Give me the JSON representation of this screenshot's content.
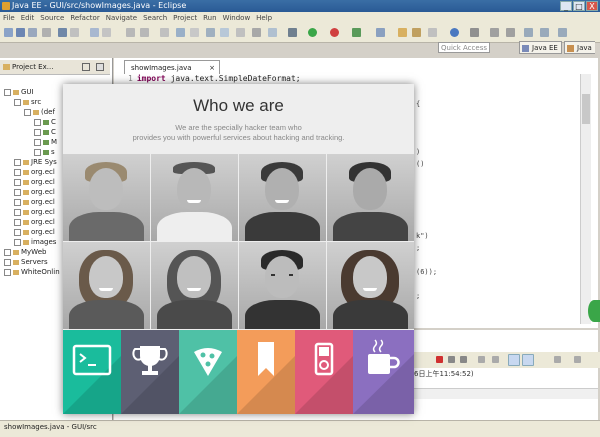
{
  "window": {
    "title": "Java EE - GUI/src/showImages.java - Eclipse",
    "buttons": [
      "_",
      "□",
      "X"
    ]
  },
  "menu": [
    "File",
    "Edit",
    "Source",
    "Refactor",
    "Navigate",
    "Search",
    "Project",
    "Run",
    "Window",
    "Help"
  ],
  "toolbar": {
    "quick_access_placeholder": "Quick Access",
    "perspectives": [
      "Java EE",
      "Java"
    ]
  },
  "project_explorer": {
    "tab_label": "Project Ex...",
    "tree": [
      {
        "label": "GUI",
        "depth": 0
      },
      {
        "label": "src",
        "depth": 1
      },
      {
        "label": "(def",
        "depth": 2
      },
      {
        "label": "C",
        "depth": 3
      },
      {
        "label": "C",
        "depth": 3
      },
      {
        "label": "M",
        "depth": 3
      },
      {
        "label": "s",
        "depth": 3
      },
      {
        "label": "JRE Sys",
        "depth": 1
      },
      {
        "label": "org.ecl",
        "depth": 1
      },
      {
        "label": "org.ecl",
        "depth": 1
      },
      {
        "label": "org.ecl",
        "depth": 1
      },
      {
        "label": "org.ecl",
        "depth": 1
      },
      {
        "label": "org.ecl",
        "depth": 1
      },
      {
        "label": "org.ecl",
        "depth": 1
      },
      {
        "label": "org.ecl",
        "depth": 1
      },
      {
        "label": "images",
        "depth": 1
      },
      {
        "label": "MyWeb",
        "depth": 0
      },
      {
        "label": "Servers",
        "depth": 0
      },
      {
        "label": "WhiteOnlin",
        "depth": 0
      }
    ]
  },
  "editor": {
    "tab_label": "showImages.java",
    "line_number": "1",
    "code_keyword": "import",
    "code_rest": "java.text.SimpleDateFormat;",
    "fragments": [
      "{",
      ")",
      "()",
      "k\")",
      ";",
      "(6));",
      ";"
    ]
  },
  "console": {
    "timestamp": "6日上午11:54:52)"
  },
  "status": {
    "text": "showImages.java - GUI/src"
  },
  "overlay": {
    "title": "Who we are",
    "subtitle_line1": "We are the specially hacker team who",
    "subtitle_line2": "provides you with powerful services about hacking and tracking.",
    "tiles": [
      {
        "icon": "terminal-icon",
        "color": "#1abc9c"
      },
      {
        "icon": "trophy-icon",
        "color": "#5d5f73"
      },
      {
        "icon": "pizza-icon",
        "color": "#4fc1a6"
      },
      {
        "icon": "bookmark-icon",
        "color": "#f39c5a"
      },
      {
        "icon": "ipod-icon",
        "color": "#e05a7a"
      },
      {
        "icon": "coffee-mug-icon",
        "color": "#8b6fc0"
      }
    ]
  }
}
